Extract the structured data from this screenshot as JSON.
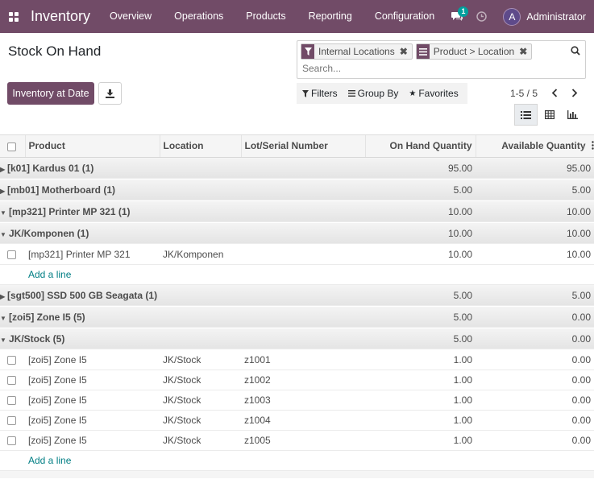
{
  "navbar": {
    "app_name": "Inventory",
    "menu": [
      "Overview",
      "Operations",
      "Products",
      "Reporting",
      "Configuration"
    ],
    "chat_badge": "1",
    "user_initial": "A",
    "user_name": "Administrator",
    "color": "#714B67"
  },
  "control_panel": {
    "title": "Stock On Hand",
    "primary_button": "Inventory at Date",
    "search": {
      "facets": [
        "Internal Locations",
        "Product > Location"
      ],
      "placeholder": "Search..."
    },
    "filters": [
      "Filters",
      "Group By",
      "Favorites"
    ],
    "pager": "1-5 / 5"
  },
  "table": {
    "headers": [
      "Product",
      "Location",
      "Lot/Serial Number",
      "On Hand Quantity",
      "Available Quantity"
    ],
    "groups": [
      {
        "name": "[k01] Kardus 01 (1)",
        "on_hand": "95.00",
        "available": "95.00"
      },
      {
        "name": "[mb01] Motherboard (1)",
        "on_hand": "5.00",
        "available": "5.00"
      },
      {
        "name": "[mp321] Printer MP 321 (1)",
        "on_hand": "10.00",
        "available": "10.00",
        "sub": {
          "name": "JK/Komponen (1)",
          "on_hand": "10.00",
          "available": "10.00"
        },
        "rows": [
          {
            "product": "[mp321] Printer MP 321",
            "location": "JK/Komponen",
            "lot": "",
            "on_hand": "10.00",
            "available": "10.00"
          }
        ]
      },
      {
        "name": "[sgt500] SSD 500 GB Seagata (1)",
        "on_hand": "5.00",
        "available": "5.00"
      },
      {
        "name": "[zoi5] Zone I5 (5)",
        "on_hand": "5.00",
        "available": "0.00",
        "sub": {
          "name": "JK/Stock (5)",
          "on_hand": "5.00",
          "available": "0.00"
        },
        "rows": [
          {
            "product": "[zoi5] Zone I5",
            "location": "JK/Stock",
            "lot": "z1001",
            "on_hand": "1.00",
            "available": "0.00"
          },
          {
            "product": "[zoi5] Zone I5",
            "location": "JK/Stock",
            "lot": "z1002",
            "on_hand": "1.00",
            "available": "0.00"
          },
          {
            "product": "[zoi5] Zone I5",
            "location": "JK/Stock",
            "lot": "z1003",
            "on_hand": "1.00",
            "available": "0.00"
          },
          {
            "product": "[zoi5] Zone I5",
            "location": "JK/Stock",
            "lot": "z1004",
            "on_hand": "1.00",
            "available": "0.00"
          },
          {
            "product": "[zoi5] Zone I5",
            "location": "JK/Stock",
            "lot": "z1005",
            "on_hand": "1.00",
            "available": "0.00"
          }
        ]
      }
    ],
    "add_line": "Add a line"
  }
}
